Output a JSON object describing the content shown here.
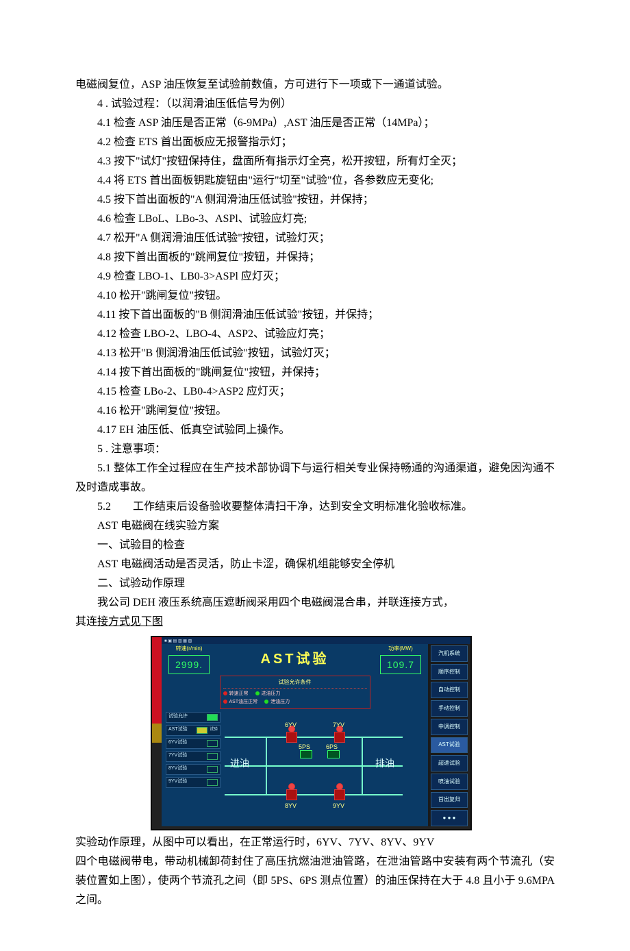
{
  "p_intro": "电磁阀复位，ASP 油压恢复至试验前数值，方可进行下一项或下一通道试验。",
  "p_4": "4 . 试验过程：（以润滑油压低信号为例）",
  "p_4_1": "4.1   检查 ASP 油压是否正常（6-9MPa）,AST 油压是否正常（14MPa）；",
  "p_4_2": "4.2   检查 ETS 首出面板应无报警指示灯；",
  "p_4_3": "4.3   按下\"试灯\"按钮保持住，盘面所有指示灯全亮，松开按钮，所有灯全灭；",
  "p_4_4": "4.4   将 ETS 首出面板钥匙旋钮由\"运行\"切至\"试验\"位，各参数应无变化;",
  "p_4_5": "4.5   按下首出面板的\"A 侧润滑油压低试验\"按钮，并保持；",
  "p_4_6": "4.6   检查 LBoL、LBo-3、ASPl、试验应灯亮;",
  "p_4_7": "4.7   松开\"A 侧润滑油压低试验\"按钮，试验灯灭；",
  "p_4_8": "4.8   按下首出面板的\"跳闸复位\"按钮，并保持；",
  "p_4_9": "4.9   检查 LBO-1、LB0-3>ASPl 应灯灭；",
  "p_4_10": "4.10   松开\"跳闸复位\"按钮。",
  "p_4_11": "4.11   按下首出面板的\"B 侧润滑油压低试验\"按钮，并保持；",
  "p_4_12": "4.12   检查 LBO-2、LBO-4、ASP2、试验应灯亮；",
  "p_4_13": "4.13   松开\"B 侧润滑油压低试验\"按钮，试验灯灭；",
  "p_4_14": "4.14   按下首出面板的\"跳闸复位\"按钮，并保持；",
  "p_4_15": "4.15   检查 LBo-2、LB0-4>ASP2 应灯灭；",
  "p_4_16": "4.16   松开\"跳闸复位\"按钮。",
  "p_4_17": "4.17   EH 油压低、低真空试验同上操作。",
  "p_5": "5 . 注意事项：",
  "p_5_1": "5.1   整体工作全过程应在生产技术部协调下与运行相关专业保持畅通的沟通渠道，避免因沟通不及时造成事故。",
  "p_5_2": "5.2　　工作结束后设备验收要整体清扫干净，达到安全文明标准化验收标准。",
  "p_ast_title": "AST 电磁阀在线实验方案",
  "p_sec1": "一、试验目的检查",
  "p_sec1_body": "AST 电磁阀活动是否灵活，防止卡涩，确保机组能够安全停机",
  "p_sec2": "二、试验动作原理",
  "p_sec2_body1": "我公司 DEH 液压系统高压遮断阀采用四个电磁阀混合串，并联连接方式，",
  "p_sec2_body2a": "其连",
  "p_sec2_body2b": "接方式见下图",
  "p_after1": "实验动作原理，从图中可以看出，在正常运行时，6YV、7YV、8YV、9YV",
  "p_after2": "四个电磁阀带电，带动机械卸荷封住了高压抗燃油泄油管路，在泄油管路中安装有两个节流孔（安装位置如上图），使两个节流孔之间（即 5PS、6PS 测点位置）的油压保持在大于 4.8 且小于 9.6MPA 之间。",
  "hmi": {
    "titlebar": "■ ▣ ▤ ▥ ▦ ▧",
    "speed_label": "转速(r/min)",
    "speed_value": "2999.",
    "main_title": "AST试验",
    "power_label": "功率(MW)",
    "power_value": "109.7",
    "cond_title": "试验允许条件",
    "cond_a1": "转速正常",
    "cond_a2": "AST油压正常",
    "cond_b1": "进油压力",
    "cond_b2": "泄油压力",
    "left_items": [
      "试验允许",
      "AST试验",
      "6YV试验",
      "7YV试验",
      "8YV试验",
      "9YV试验"
    ],
    "left_extra": "试验",
    "v_6yv": "6YV",
    "v_7yv": "7YV",
    "v_8yv": "8YV",
    "v_9yv": "9YV",
    "s_5ps": "5PS",
    "s_6ps": "6PS",
    "in_oil": "进油",
    "out_oil": "排油",
    "right_buttons": [
      "汽机系统",
      "顺序控制",
      "自动控制",
      "手动控制",
      "中调控制",
      "AST试验",
      "超速试验",
      "喷油试验",
      "首出复归",
      "● ● ●"
    ]
  }
}
